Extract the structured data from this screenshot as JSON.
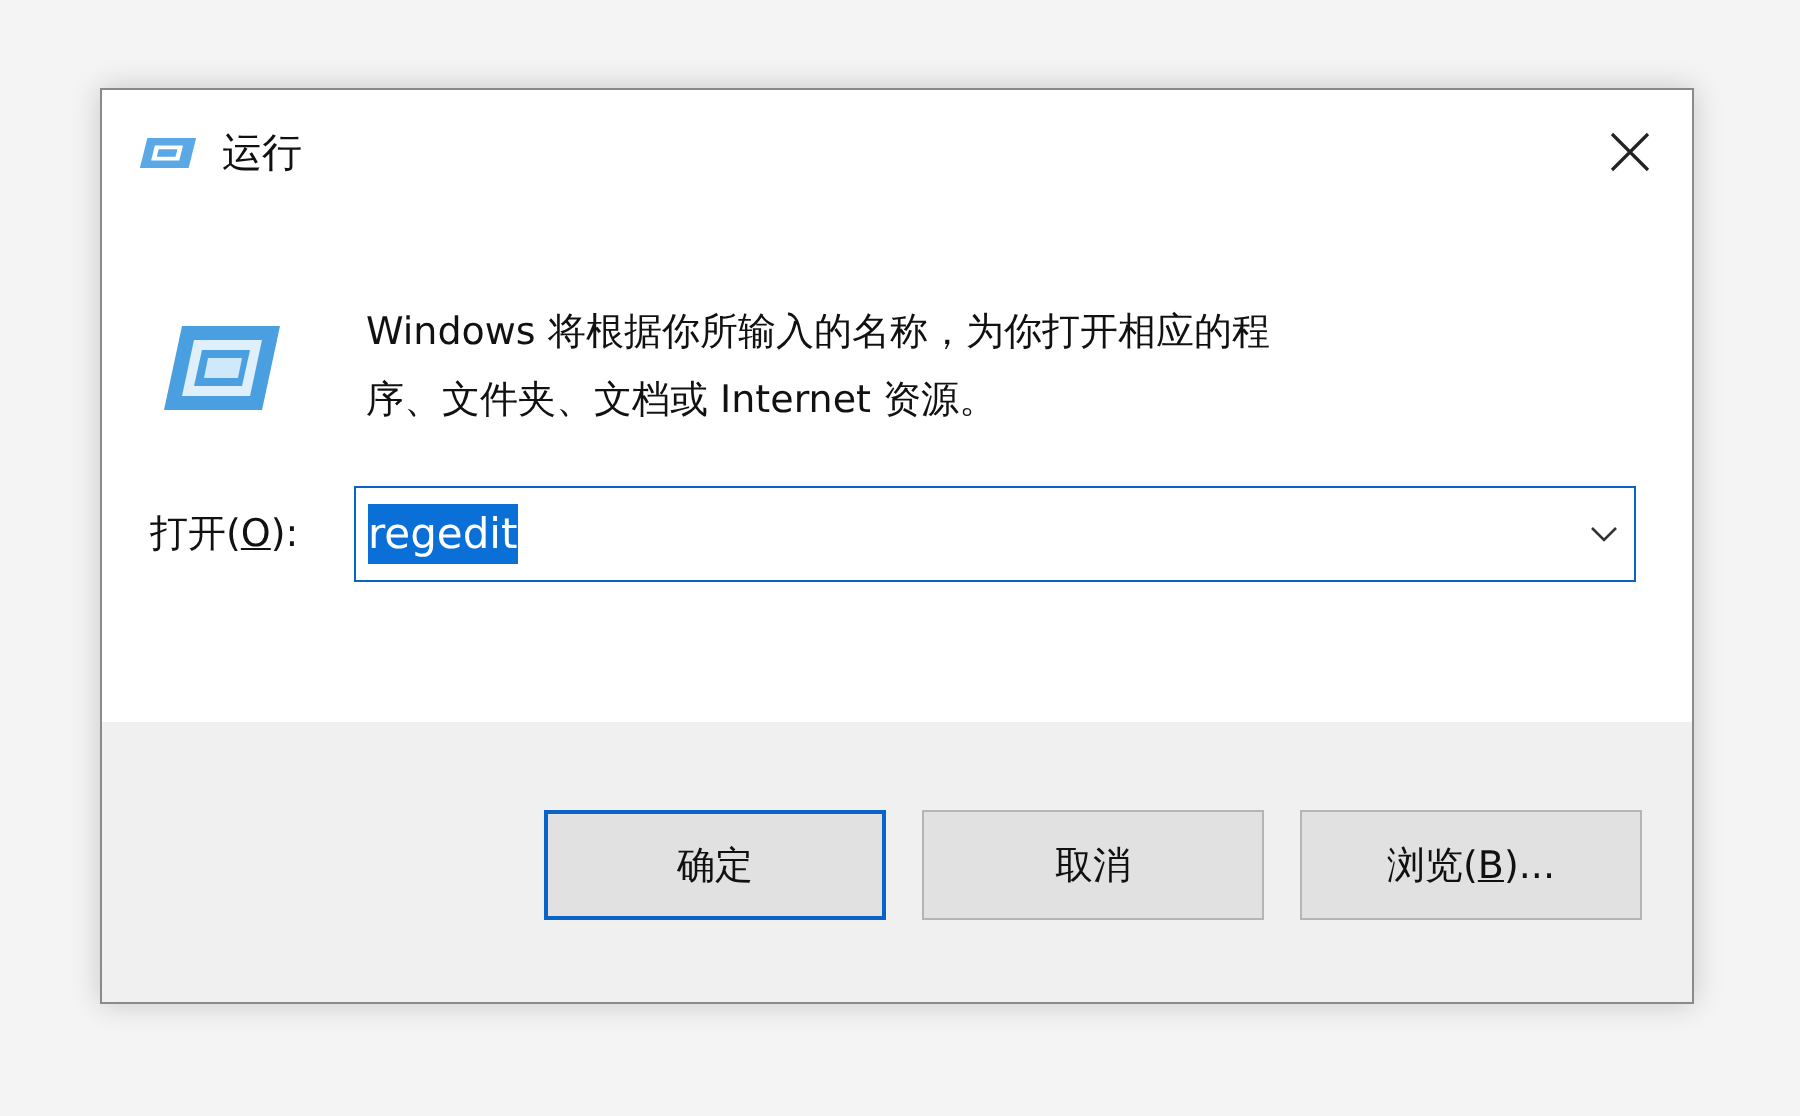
{
  "window": {
    "title": "运行"
  },
  "description": "Windows 将根据你所输入的名称，为你打开相应的程序、文件夹、文档或 Internet 资源。",
  "open_field": {
    "label": {
      "before": "打开(",
      "key": "O",
      "after": "):"
    },
    "value": "regedit",
    "text_selected": true
  },
  "buttons": [
    {
      "before": "确定",
      "default": true
    },
    {
      "before": "取消",
      "default": false
    },
    {
      "before": "浏览(",
      "key": "B",
      "after": ")...",
      "default": false
    }
  ]
}
